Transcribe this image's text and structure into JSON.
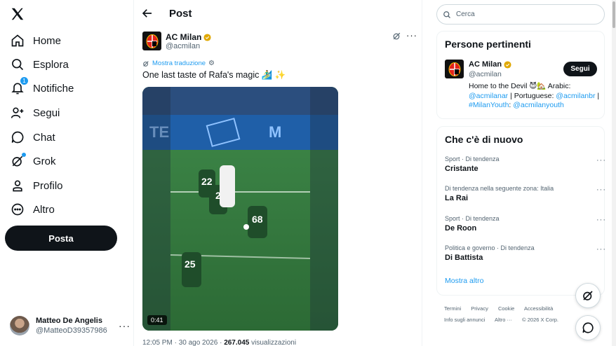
{
  "nav": {
    "items": [
      {
        "label": "Home",
        "icon": "home-icon"
      },
      {
        "label": "Esplora",
        "icon": "search-icon"
      },
      {
        "label": "Notifiche",
        "icon": "bell-icon",
        "badge": "1"
      },
      {
        "label": "Segui",
        "icon": "follow-icon"
      },
      {
        "label": "Chat",
        "icon": "chat-icon"
      },
      {
        "label": "Grok",
        "icon": "grok-icon"
      },
      {
        "label": "Profilo",
        "icon": "person-icon"
      },
      {
        "label": "Altro",
        "icon": "more-circle-icon"
      }
    ],
    "post_button": "Posta"
  },
  "account": {
    "name": "Matteo De Angelis",
    "handle": "@MatteoD39357986"
  },
  "header": {
    "title": "Post"
  },
  "tweet": {
    "author_name": "AC Milan",
    "author_handle": "@acmilan",
    "translate_label": "Mostra traduzione",
    "text": "One last taste of Rafa's magic 🏄‍♂️ ✨",
    "video_duration": "0:41",
    "time": "12:05 PM · 30 ago 2026 · ",
    "views": "267.045",
    "views_label": " visualizzazioni"
  },
  "search": {
    "placeholder": "Cerca"
  },
  "relevant": {
    "title": "Persone pertinenti",
    "name": "AC Milan",
    "handle": "@acmilan",
    "follow_label": "Segui",
    "bio_1": "Home to the Devil 😈🏡 Arabic:",
    "bio_link_1": "@acmilanar",
    "bio_sep_1": " | Portuguese: ",
    "bio_link_2": "@acmilanbr",
    "bio_sep_2": " |",
    "bio_link_3": "#MilanYouth",
    "bio_sep_3": ": ",
    "bio_link_4": "@acmilanyouth"
  },
  "trends": {
    "title": "Che c'è di nuovo",
    "items": [
      {
        "context": "Sport · Di tendenza",
        "title": "Cristante"
      },
      {
        "context": "Di tendenza nella seguente zona: Italia",
        "title": "La Rai"
      },
      {
        "context": "Sport · Di tendenza",
        "title": "De Roon"
      },
      {
        "context": "Politica e governo · Di tendenza",
        "title": "Di Battista"
      }
    ],
    "show_more": "Mostra altro"
  },
  "footer": {
    "links": [
      "Termini",
      "Privacy",
      "Cookie",
      "Accessibilità",
      "Info sugli annunci",
      "Altro ···",
      "© 2026 X Corp."
    ]
  },
  "colors": {
    "accent": "#1d9bf0",
    "text": "#0f1419",
    "muted": "#536471",
    "verified": "#e0a800"
  }
}
